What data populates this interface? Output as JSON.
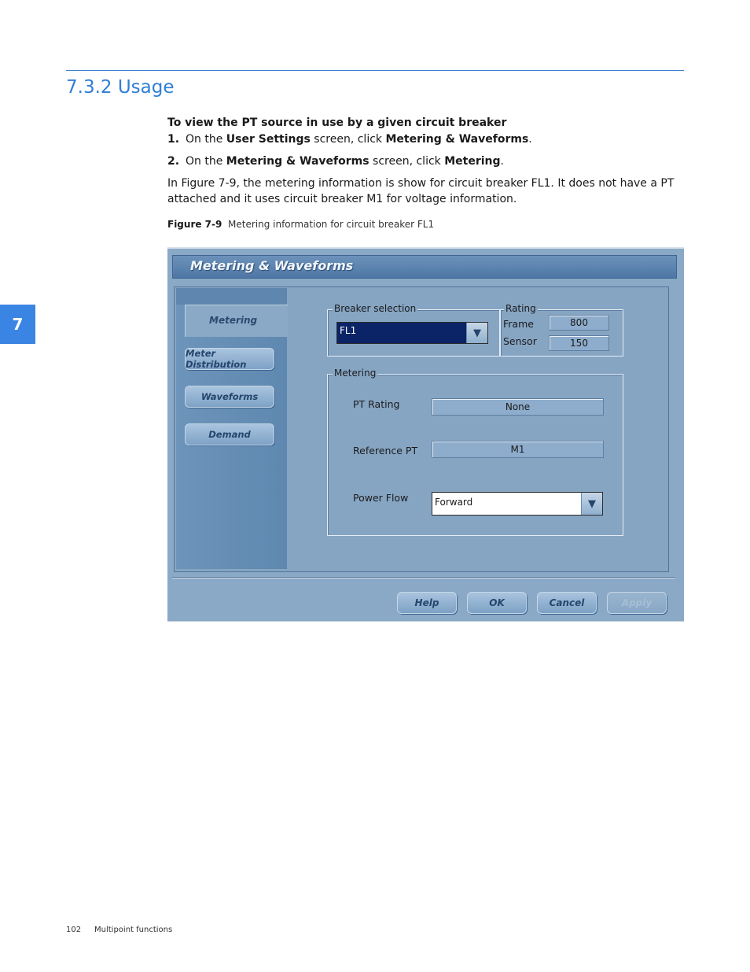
{
  "page": {
    "section_title": "7.3.2 Usage",
    "chapter_tab": "7",
    "procedure_heading": "To view the PT source in use by a given circuit breaker",
    "steps": [
      {
        "num": "1.",
        "pre": "On the ",
        "bold1": "User Settings",
        "mid": " screen, click ",
        "bold2": "Metering & Waveforms",
        "post": "."
      },
      {
        "num": "2.",
        "pre": "On the ",
        "bold1": "Metering & Waveforms",
        "mid": " screen, click ",
        "bold2": "Metering",
        "post": "."
      }
    ],
    "paragraph": "In Figure 7-9, the metering information is show for circuit breaker FL1. It does not have a PT attached and it uses circuit breaker M1 for voltage information.",
    "figure_label": "Figure 7-9",
    "figure_caption": "Metering information for circuit breaker FL1",
    "footer_page": "102",
    "footer_title": "Multipoint functions"
  },
  "window": {
    "title": "Metering & Waveforms",
    "active_tab": "Metering",
    "sidebar_buttons": [
      "Meter Distribution",
      "Waveforms",
      "Demand"
    ],
    "breaker_selection": {
      "legend": "Breaker selection",
      "value": "FL1"
    },
    "rating": {
      "legend": "Rating",
      "frame_label": "Frame",
      "frame_value": "800",
      "sensor_label": "Sensor",
      "sensor_value": "150"
    },
    "metering": {
      "legend": "Metering",
      "pt_rating_label": "PT Rating",
      "pt_rating_value": "None",
      "reference_pt_label": "Reference PT",
      "reference_pt_value": "M1",
      "power_flow_label": "Power Flow",
      "power_flow_value": "Forward"
    },
    "buttons": {
      "help": "Help",
      "ok": "OK",
      "cancel": "Cancel",
      "apply": "Apply"
    },
    "icons": {
      "dropdown": "chevron-down-icon"
    }
  },
  "colors": {
    "accent": "#2f7fd6",
    "chapter_tab": "#3a85e3",
    "dialog_bg": "#8aa9c6",
    "selected_combo": "#0a2467"
  }
}
